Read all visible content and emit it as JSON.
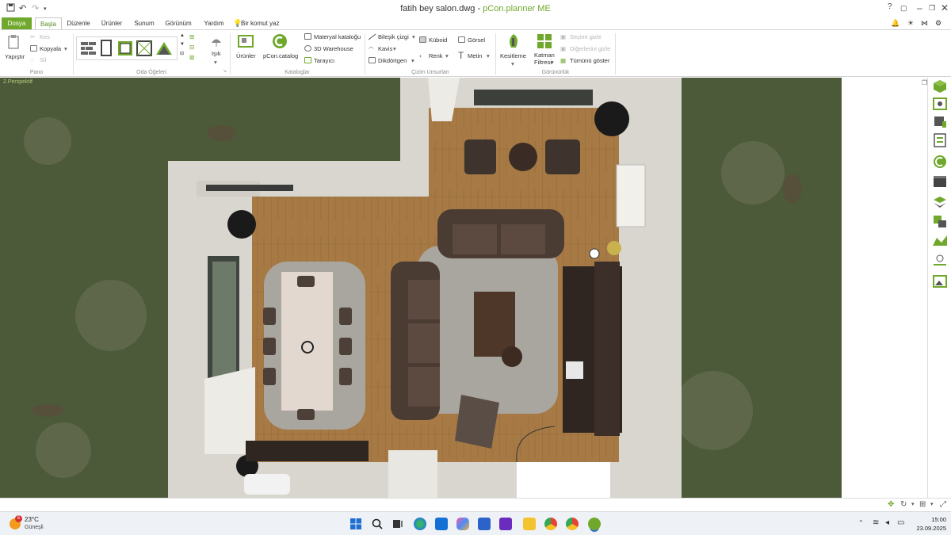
{
  "window": {
    "filename": "fatih bey salon.dwg",
    "separator": " - ",
    "app_name": "pCon.planner ME"
  },
  "tabs": [
    "Dosya",
    "Başla",
    "Düzenle",
    "Ürünler",
    "Sunum",
    "Görünüm",
    "Yardım"
  ],
  "active_tab": "Başla",
  "command_search": "Bir komut yaz",
  "ribbon": {
    "pano": {
      "group_label": "Pano",
      "paste": "Yapıştır",
      "cut": "Kes",
      "copy": "Kopyala",
      "delete": "Sil"
    },
    "oda": {
      "group_label": "Oda Öğeleri",
      "light": "Işık"
    },
    "kataloglar": {
      "group_label": "Kataloglar",
      "products": "Ürünler",
      "pcon_catalog": "pCon.catalog",
      "material_catalog": "Materyal kataloğu",
      "warehouse": "3D Warehouse",
      "browser": "Tarayıcı"
    },
    "cizim": {
      "group_label": "Çizim Unsurları",
      "composite_line": "Bileşik çizgi",
      "arc": "Kavis",
      "rectangle": "Dikdörtgen",
      "cuboid": "Küboid",
      "color": "Renk",
      "image": "Görsel",
      "text": "Metin"
    },
    "gorunurluk": {
      "group_label": "Görünürlük",
      "section": "Kesitleme",
      "layer_filter_1": "Katman",
      "layer_filter_2": "Filtresi",
      "hide_selection": "Seçimi gizle",
      "hide_others": "Diğerlerini gizle",
      "show_all": "Tümünü göster"
    }
  },
  "viewport": {
    "label": "2.Perspektif"
  },
  "taskbar": {
    "weather_temp": "23°C",
    "weather_desc": "Güneşli",
    "weather_badge": "5",
    "time": "15:00",
    "date": "23.09.2025"
  },
  "colors": {
    "accent_green": "#6fa82c",
    "grass": "#4c5a3a",
    "wood_floor": "#a77a45",
    "wall": "#d8d6cf",
    "sofa": "#4a3b33",
    "rug": "#a9a69f"
  }
}
